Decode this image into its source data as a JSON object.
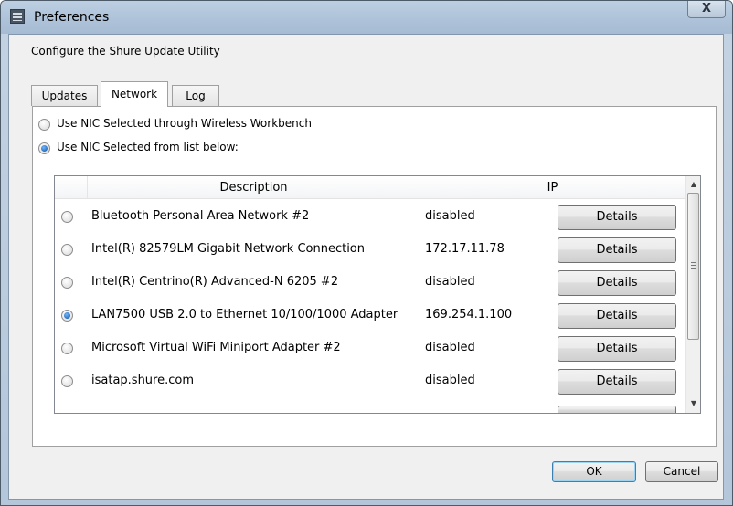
{
  "window": {
    "title": "Preferences",
    "close_label": "X"
  },
  "header": {
    "configure_text": "Configure the Shure Update Utility"
  },
  "tabs": [
    {
      "label": "Updates",
      "active": false
    },
    {
      "label": "Network",
      "active": true
    },
    {
      "label": "Log",
      "active": false
    }
  ],
  "network": {
    "options": [
      {
        "label": "Use NIC Selected through Wireless Workbench",
        "checked": false
      },
      {
        "label": "Use NIC Selected from list below:",
        "checked": true
      }
    ],
    "table": {
      "columns": [
        "Description",
        "IP"
      ],
      "rows": [
        {
          "description": "Bluetooth Personal Area Network #2",
          "ip": "disabled",
          "button": "Details",
          "selected": false
        },
        {
          "description": "Intel(R) 82579LM Gigabit Network Connection",
          "ip": "172.17.11.78",
          "button": "Details",
          "selected": false
        },
        {
          "description": "Intel(R) Centrino(R) Advanced-N 6205 #2",
          "ip": "disabled",
          "button": "Details",
          "selected": false
        },
        {
          "description": "LAN7500 USB 2.0 to Ethernet 10/100/1000 Adapter",
          "ip": "169.254.1.100",
          "button": "Details",
          "selected": true
        },
        {
          "description": "Microsoft Virtual WiFi Miniport Adapter #2",
          "ip": "disabled",
          "button": "Details",
          "selected": false
        },
        {
          "description": "isatap.shure.com",
          "ip": "disabled",
          "button": "Details",
          "selected": false
        }
      ]
    }
  },
  "footer": {
    "ok_label": "OK",
    "cancel_label": "Cancel"
  }
}
